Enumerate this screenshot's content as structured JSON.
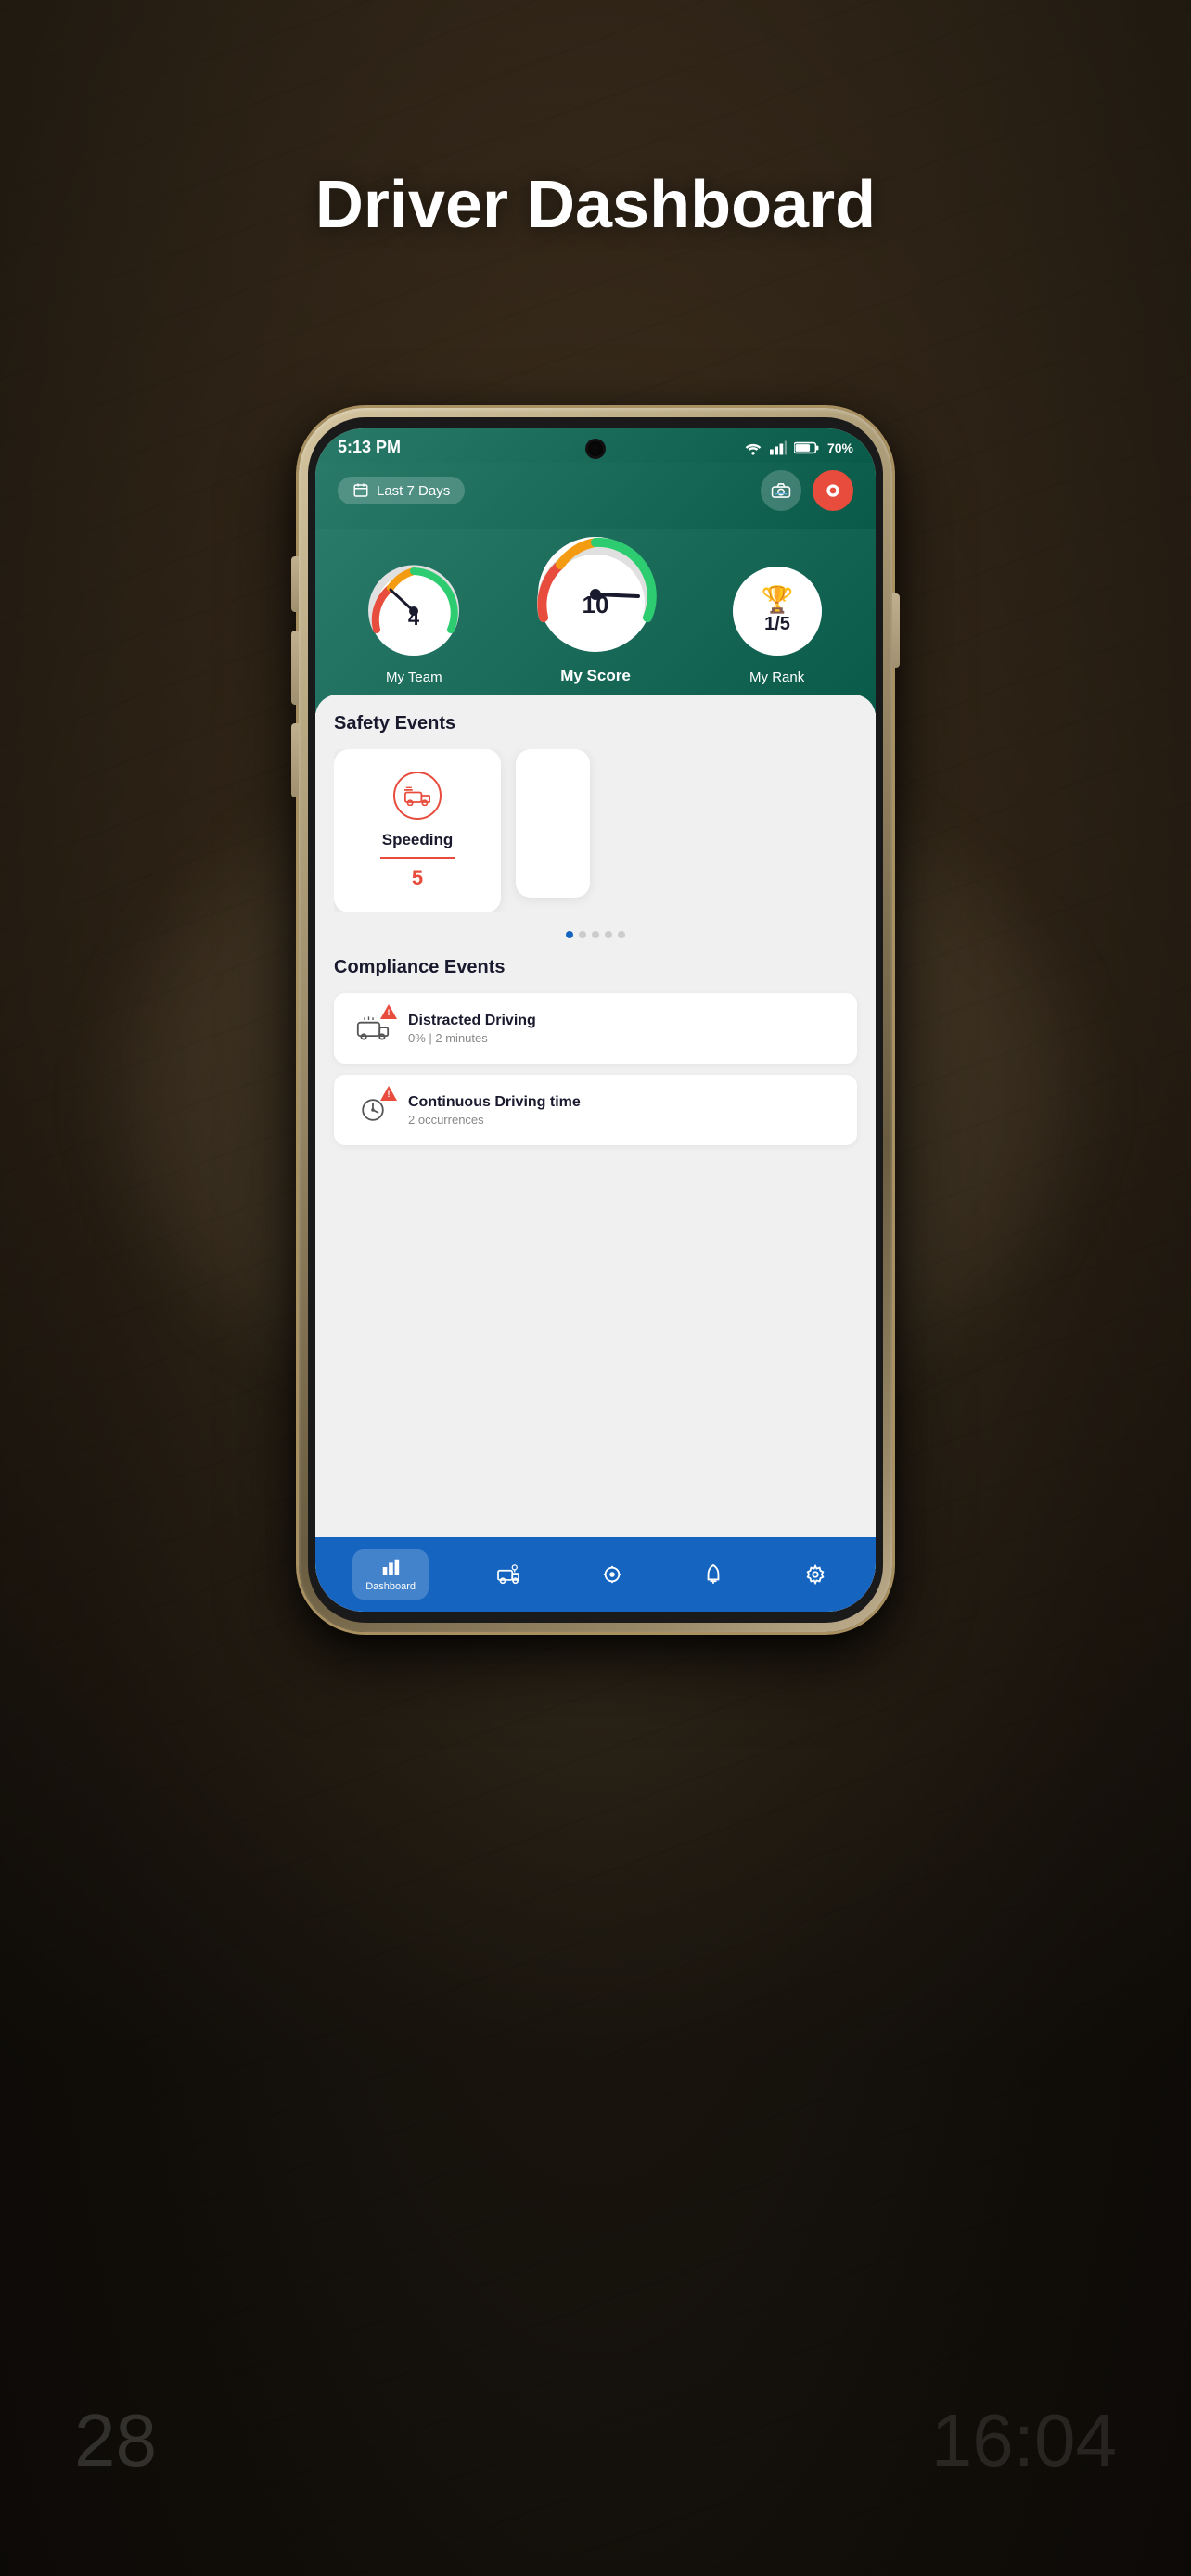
{
  "page": {
    "title": "Driver Dashboard",
    "background": "car-interior"
  },
  "status_bar": {
    "time": "5:13 PM",
    "battery": "70%",
    "signal": "wifi+lte"
  },
  "header": {
    "date_filter": "Last 7 Days",
    "calendar_icon": "calendar-icon",
    "car_icon": "car-camera-icon",
    "record_icon": "record-icon"
  },
  "scores": {
    "my_team": {
      "label": "My Team",
      "value": 4,
      "max": 10
    },
    "my_score": {
      "label": "My Score",
      "value": 10,
      "max": 10
    },
    "my_rank": {
      "label": "My Rank",
      "value": "1/5"
    }
  },
  "safety_events": {
    "section_title": "Safety Events",
    "cards": [
      {
        "name": "Speeding",
        "count": 5,
        "icon": "speeding-icon"
      }
    ],
    "dots": [
      "active",
      "inactive",
      "inactive",
      "inactive",
      "inactive"
    ]
  },
  "compliance_events": {
    "section_title": "Compliance Events",
    "items": [
      {
        "name": "Distracted Driving",
        "detail": "0% | 2 minutes",
        "icon": "distracted-driving-icon",
        "has_alert": true
      },
      {
        "name": "Continuous Driving time",
        "detail": "2 occurrences",
        "icon": "continuous-driving-icon",
        "has_alert": true
      }
    ]
  },
  "bottom_nav": {
    "items": [
      {
        "label": "Dashboard",
        "icon": "chart-icon",
        "active": true
      },
      {
        "label": "",
        "icon": "truck-location-icon",
        "active": false
      },
      {
        "label": "",
        "icon": "route-icon",
        "active": false
      },
      {
        "label": "",
        "icon": "bell-icon",
        "active": false
      },
      {
        "label": "",
        "icon": "settings-icon",
        "active": false
      }
    ]
  }
}
